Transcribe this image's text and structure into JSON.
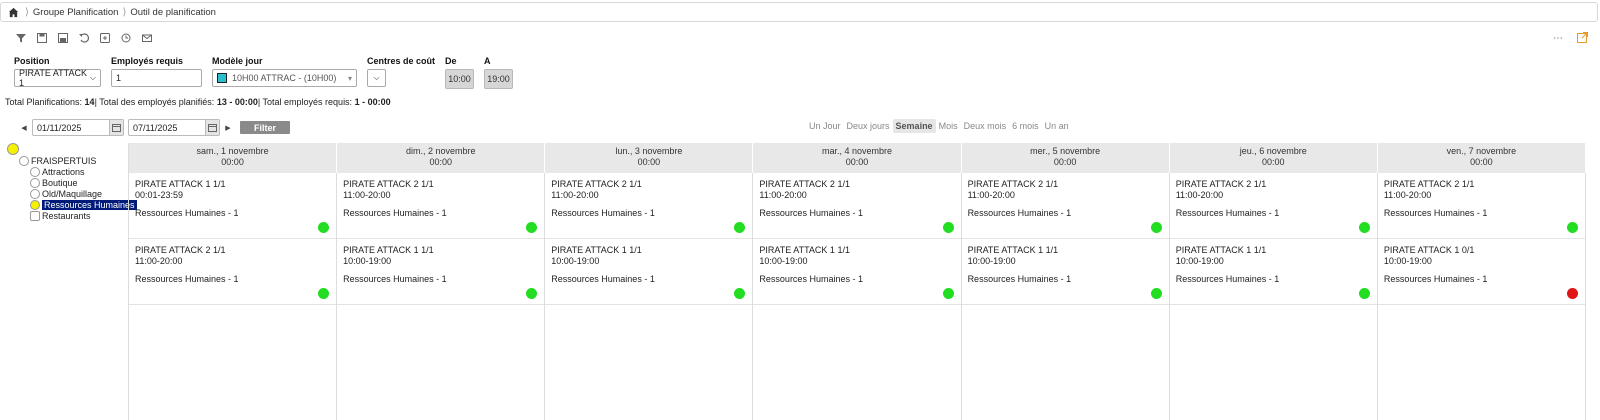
{
  "breadcrumb": {
    "items": [
      "Groupe Planification",
      "Outil de planification"
    ]
  },
  "toolbar": {
    "icons": [
      "filter-icon",
      "save-icon",
      "save-as-icon",
      "undo-icon",
      "export-icon",
      "history-icon",
      "mail-icon"
    ]
  },
  "form": {
    "position": {
      "label": "Position",
      "value": "PIRATE ATTACK 1"
    },
    "employes": {
      "label": "Employés requis",
      "value": "1"
    },
    "modele": {
      "label": "Modèle jour",
      "value": "10H00 ATTRAC - (10H00)"
    },
    "centres": {
      "label": "Centres de coût"
    },
    "de": {
      "label": "De",
      "value": "10:00"
    },
    "a": {
      "label": "A",
      "value": "19:00"
    }
  },
  "summary": {
    "p1": "Total Planifications: ",
    "v1": "14",
    "p2": "| Total des employés planifiés: ",
    "v2": "13 - 00:00",
    "p3": "| Total employés requis: ",
    "v3": "1 - 00:00"
  },
  "datenav": {
    "from": "01/11/2025",
    "to": "07/11/2025",
    "filter": "Filter"
  },
  "views": [
    "Un Jour",
    "Deux jours",
    "Semaine",
    "Mois",
    "Deux mois",
    "6 mois",
    "Un an"
  ],
  "active_view": "Semaine",
  "tree": {
    "root": "FRAISPERTUIS",
    "children": [
      "Attractions",
      "Boutique",
      "Old/Maquillage",
      "Ressources Humaines",
      "Restaurants"
    ],
    "selected": "Ressources Humaines"
  },
  "days": [
    {
      "name": "sam., 1 novembre",
      "time": "00:00",
      "shifts": [
        {
          "title": "PIRATE ATTACK 1 1/1",
          "hours": "00:01-23:59",
          "res": "Ressources Humaines - 1",
          "status": "green"
        },
        {
          "title": "PIRATE ATTACK 2 1/1",
          "hours": "11:00-20:00",
          "res": "Ressources Humaines - 1",
          "status": "green"
        }
      ]
    },
    {
      "name": "dim., 2 novembre",
      "time": "00:00",
      "shifts": [
        {
          "title": "PIRATE ATTACK 2 1/1",
          "hours": "11:00-20:00",
          "res": "Ressources Humaines - 1",
          "status": "green"
        },
        {
          "title": "PIRATE ATTACK 1 1/1",
          "hours": "10:00-19:00",
          "res": "Ressources Humaines - 1",
          "status": "green"
        }
      ]
    },
    {
      "name": "lun., 3 novembre",
      "time": "00:00",
      "shifts": [
        {
          "title": "PIRATE ATTACK 2 1/1",
          "hours": "11:00-20:00",
          "res": "Ressources Humaines - 1",
          "status": "green"
        },
        {
          "title": "PIRATE ATTACK 1 1/1",
          "hours": "10:00-19:00",
          "res": "Ressources Humaines - 1",
          "status": "green"
        }
      ]
    },
    {
      "name": "mar., 4 novembre",
      "time": "00:00",
      "shifts": [
        {
          "title": "PIRATE ATTACK 2 1/1",
          "hours": "11:00-20:00",
          "res": "Ressources Humaines - 1",
          "status": "green"
        },
        {
          "title": "PIRATE ATTACK 1 1/1",
          "hours": "10:00-19:00",
          "res": "Ressources Humaines - 1",
          "status": "green"
        }
      ]
    },
    {
      "name": "mer., 5 novembre",
      "time": "00:00",
      "shifts": [
        {
          "title": "PIRATE ATTACK 2 1/1",
          "hours": "11:00-20:00",
          "res": "Ressources Humaines - 1",
          "status": "green"
        },
        {
          "title": "PIRATE ATTACK 1 1/1",
          "hours": "10:00-19:00",
          "res": "Ressources Humaines - 1",
          "status": "green"
        }
      ]
    },
    {
      "name": "jeu., 6 novembre",
      "time": "00:00",
      "shifts": [
        {
          "title": "PIRATE ATTACK 2 1/1",
          "hours": "11:00-20:00",
          "res": "Ressources Humaines - 1",
          "status": "green"
        },
        {
          "title": "PIRATE ATTACK 1 1/1",
          "hours": "10:00-19:00",
          "res": "Ressources Humaines - 1",
          "status": "green"
        }
      ]
    },
    {
      "name": "ven., 7 novembre",
      "time": "00:00",
      "shifts": [
        {
          "title": "PIRATE ATTACK 2 1/1",
          "hours": "11:00-20:00",
          "res": "Ressources Humaines - 1",
          "status": "green"
        },
        {
          "title": "PIRATE ATTACK 1 0/1",
          "hours": "10:00-19:00",
          "res": "Ressources Humaines - 1",
          "status": "red"
        }
      ]
    }
  ],
  "colors": {
    "green": "#22dd22",
    "red": "#e01515",
    "accent": "#001a7a",
    "tree_yellow": "#f5f200"
  }
}
